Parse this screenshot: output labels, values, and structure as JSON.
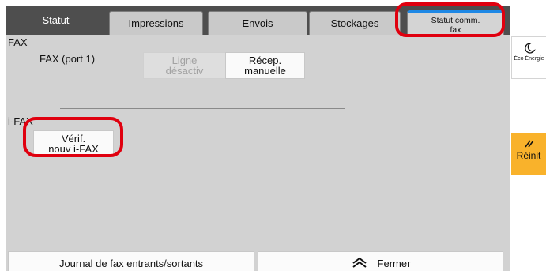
{
  "tabs": [
    {
      "label": "Statut",
      "active": true
    },
    {
      "label": "Impressions"
    },
    {
      "label": "Envois"
    },
    {
      "label": "Stockages"
    },
    {
      "label": "Statut comm.\nfax"
    }
  ],
  "fax": {
    "section_label": "FAX",
    "port_label": "FAX (port 1)",
    "line_off_button": "Ligne\ndésactiv",
    "manual_receive_button": "Récep.\nmanuelle"
  },
  "ifax": {
    "section_label": "i-FAX",
    "check_button": "Vérif.\nnouv i-FAX"
  },
  "side": {
    "eco_label": "Éco Énergie",
    "reset_label": "Réinit"
  },
  "bottom": {
    "journal_button": "Journal de fax entrants/sortants",
    "close_button": "Fermer"
  },
  "colors": {
    "highlight_ring": "#e0000f",
    "reset_button": "#f9b22b",
    "tab_accent": "#1e88e5"
  }
}
